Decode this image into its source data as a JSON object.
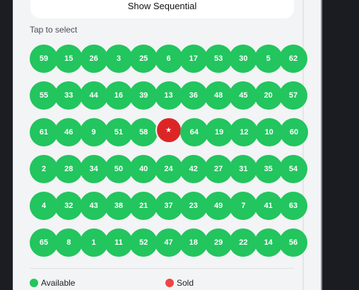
{
  "header": {
    "show_sequential_label": "Show Sequential"
  },
  "selection": {
    "hint": "Tap to select"
  },
  "grid": {
    "rows": [
      [
        "59",
        "15",
        "26",
        "3",
        "25",
        "6",
        "17",
        "53",
        "30",
        "5",
        "62"
      ],
      [
        "55",
        "33",
        "44",
        "16",
        "39",
        "13",
        "36",
        "48",
        "45",
        "20",
        "57"
      ],
      [
        "61",
        "46",
        "9",
        "51",
        "58",
        "★",
        "64",
        "19",
        "12",
        "10",
        "60"
      ],
      [
        "2",
        "28",
        "34",
        "50",
        "40",
        "24",
        "42",
        "27",
        "31",
        "35",
        "54"
      ],
      [
        "4",
        "32",
        "43",
        "38",
        "21",
        "37",
        "23",
        "49",
        "7",
        "41",
        "63"
      ],
      [
        "65",
        "8",
        "1",
        "11",
        "52",
        "47",
        "18",
        "29",
        "22",
        "14",
        "56"
      ]
    ],
    "sold_marker": "★"
  },
  "legend": {
    "available_label": "Available",
    "sold_label": "Sold"
  },
  "colors": {
    "available": "#22c55e",
    "sold": "#dc2626",
    "legend_sold": "#ef4444"
  }
}
